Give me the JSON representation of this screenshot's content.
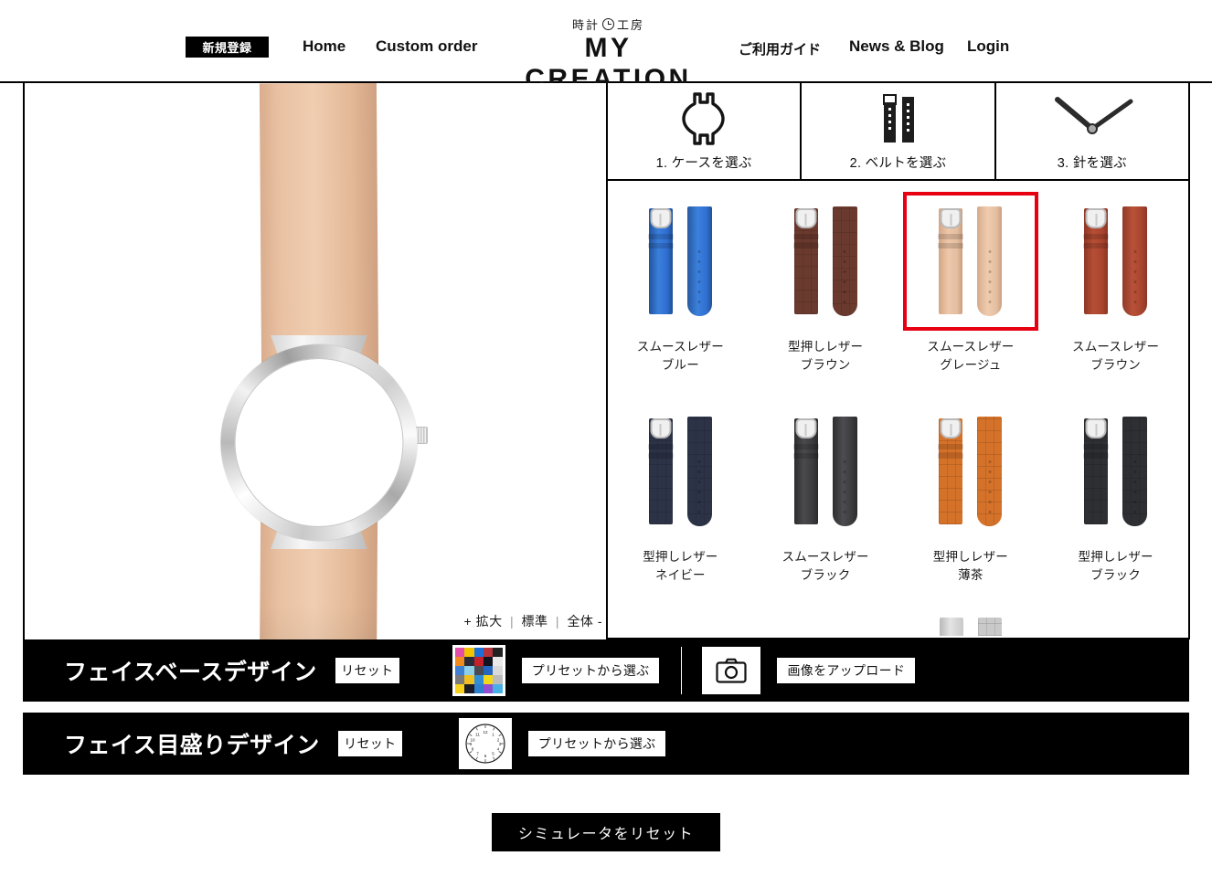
{
  "header": {
    "signup_label": "新規登録",
    "nav": [
      {
        "label": "Home"
      },
      {
        "label": "Custom order"
      },
      {
        "label": "ご利用ガイド"
      },
      {
        "label": "News & Blog"
      },
      {
        "label": "Login"
      }
    ],
    "logo": {
      "tagline_left": "時計",
      "tagline_right": "工房",
      "brand": "MY CREATION",
      "icon": "clock-icon"
    }
  },
  "preview": {
    "zoom_plus": "+ 拡大",
    "zoom_standard": "標準",
    "zoom_whole": "全体 -",
    "separator": "|",
    "case_material": "silver",
    "strap_color": "#edc3a5"
  },
  "picker": {
    "tabs": [
      {
        "label": "1. ケースを選ぶ",
        "icon": "watch-case-icon",
        "active": false
      },
      {
        "label": "2. ベルトを選ぶ",
        "icon": "watch-strap-icon",
        "active": true
      },
      {
        "label": "3. 針を選ぶ",
        "icon": "watch-hands-icon",
        "active": false
      }
    ],
    "items": [
      {
        "line1": "スムースレザー",
        "line2": "ブルー",
        "color": "#2f6fd0",
        "texture": "smooth",
        "selected": false
      },
      {
        "line1": "型押しレザー",
        "line2": "ブラウン",
        "color": "#6b3a2e",
        "texture": "croc",
        "selected": false
      },
      {
        "line1": "スムースレザー",
        "line2": "グレージュ",
        "color": "#e2bda0",
        "texture": "smooth",
        "selected": true
      },
      {
        "line1": "スムースレザー",
        "line2": "ブラウン",
        "color": "#a8442e",
        "texture": "smooth",
        "selected": false
      },
      {
        "line1": "型押しレザー",
        "line2": "ネイビー",
        "color": "#2c3346",
        "texture": "croc",
        "selected": false
      },
      {
        "line1": "スムースレザー",
        "line2": "ブラック",
        "color": "#3b3b3e",
        "texture": "smooth",
        "selected": false
      },
      {
        "line1": "型押しレザー",
        "line2": "薄茶",
        "color": "#d5722a",
        "texture": "croc",
        "selected": false
      },
      {
        "line1": "型押しレザー",
        "line2": "ブラック",
        "color": "#2e2f33",
        "texture": "croc",
        "selected": false
      }
    ],
    "selection_highlight_color": "#e60012"
  },
  "controls": {
    "rows": [
      {
        "title": "フェイスベースデザイン",
        "reset_label": "リセット",
        "preset_label": "プリセットから選ぶ",
        "swatch": "photo-mosaic-thumbnail",
        "upload_label": "画像をアップロード",
        "camera_icon": "camera-icon",
        "has_upload": true
      },
      {
        "title": "フェイス目盛りデザイン",
        "reset_label": "リセット",
        "preset_label": "プリセットから選ぶ",
        "swatch": "clock-dial-thumbnail",
        "has_upload": false
      }
    ]
  },
  "footer": {
    "reset_simulator_label": "シミュレータをリセット"
  }
}
